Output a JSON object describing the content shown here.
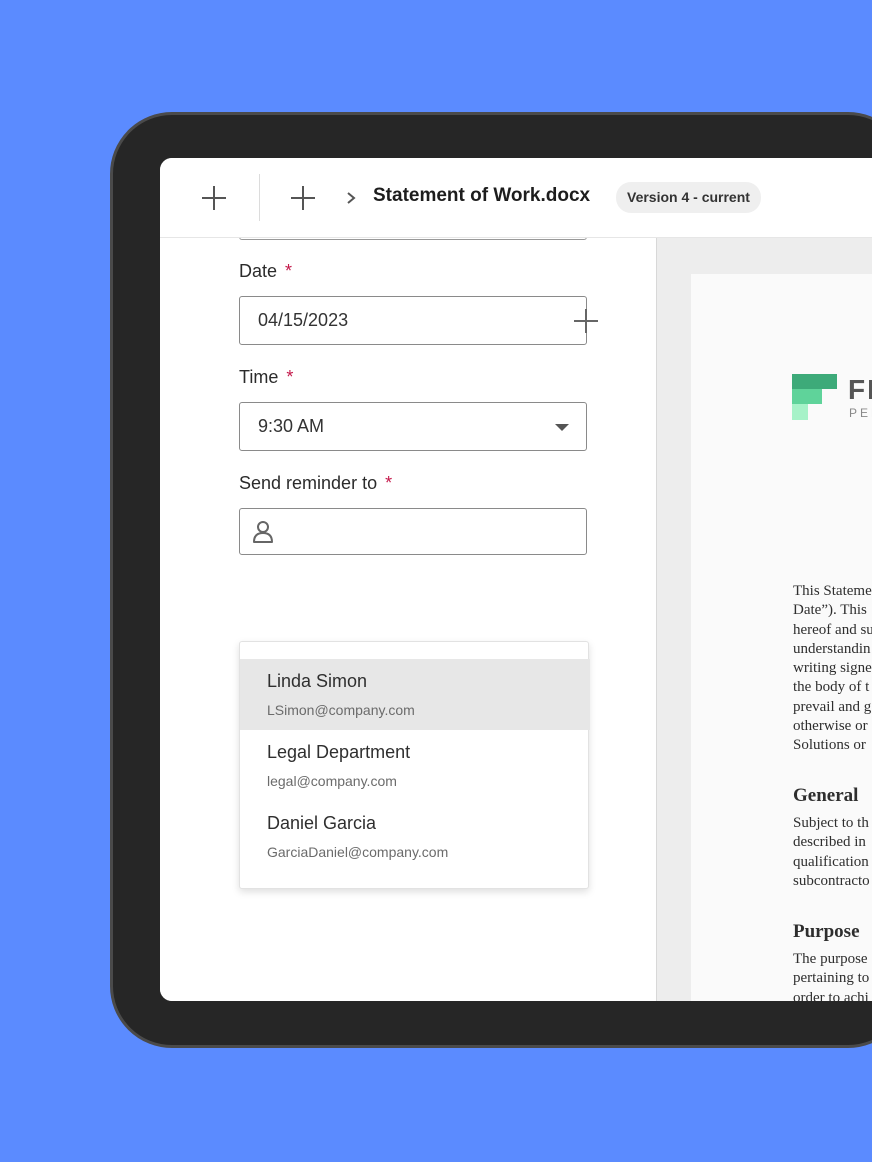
{
  "toolbar": {
    "doc_title": "Statement of Work.docx",
    "version_badge": "Version 4 - current"
  },
  "form": {
    "date": {
      "label": "Date",
      "required_mark": "*",
      "value": "04/15/2023"
    },
    "time": {
      "label": "Time",
      "required_mark": "*",
      "value": "9:30 AM"
    },
    "reminder": {
      "label": "Send reminder to",
      "required_mark": "*",
      "value": ""
    },
    "suggestions": [
      {
        "name": "Linda Simon",
        "email": "LSimon@company.com",
        "highlighted": true
      },
      {
        "name": "Legal Department",
        "email": "legal@company.com",
        "highlighted": false
      },
      {
        "name": "Daniel Garcia",
        "email": "GarciaDaniel@company.com",
        "highlighted": false
      }
    ]
  },
  "document": {
    "logo_text": "FI",
    "logo_subtitle": "PER",
    "intro_lines": [
      "This Stateme",
      "Date”). This",
      "hereof and su",
      "understandin",
      "writing signe",
      "the body of t",
      "prevail and g",
      "otherwise or",
      "Solutions or"
    ],
    "sections": [
      {
        "heading": "General",
        "lines": [
          "Subject to th",
          "described in",
          "qualification",
          "subcontracto"
        ]
      },
      {
        "heading": "Purpose",
        "lines": [
          "The purpose",
          "pertaining to",
          "order to achi"
        ]
      }
    ]
  },
  "colors": {
    "background": "#5b8bff",
    "required": "#c4184a",
    "logo_dark": "#3daa79",
    "logo_mid": "#5fd39a",
    "logo_light": "#a6f2c8"
  }
}
